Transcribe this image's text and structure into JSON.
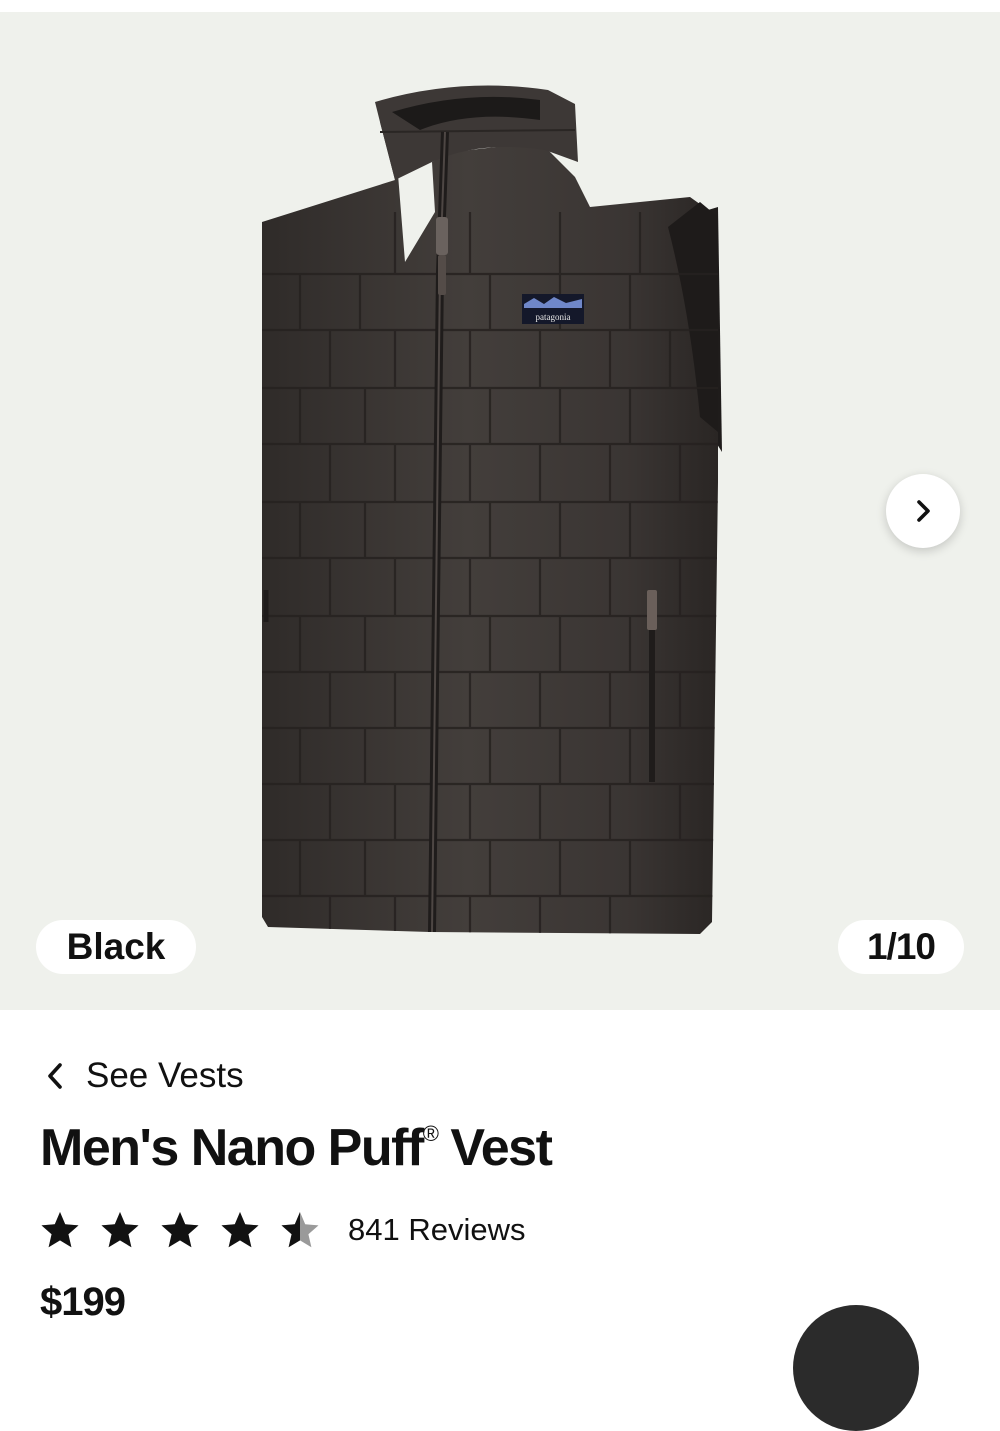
{
  "gallery": {
    "color_label": "Black",
    "counter": "1/10",
    "brand_patch": "patagonia",
    "icons": {
      "next": "chevron-right-icon"
    }
  },
  "product": {
    "back_label": "See Vests",
    "title_main": "Men's Nano Puff",
    "title_mark": "®",
    "title_end": " Vest",
    "rating": 4.5,
    "rating_max": 5,
    "reviews_label": "841 Reviews",
    "price": "$199"
  },
  "colors": {
    "gallery_bg": "#eff1ec",
    "vest": "#3a3634",
    "text": "#111111",
    "fab": "#2b2b2b"
  }
}
